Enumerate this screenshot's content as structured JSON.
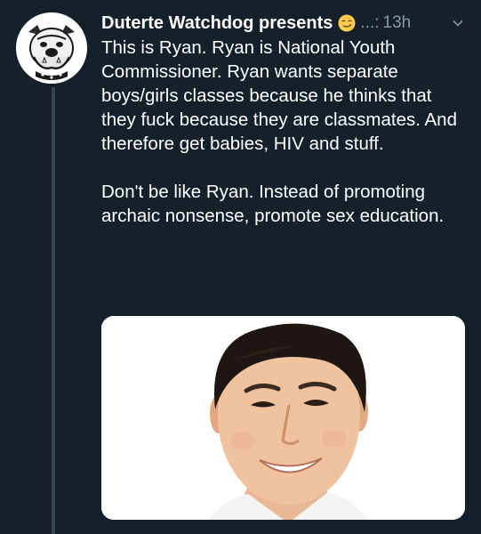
{
  "tweet": {
    "author_name": "Duterte Watchdog presents",
    "name_emoji": "smirk-emoji",
    "handle_truncated": "...:",
    "timestamp": "13h",
    "paragraphs": [
      "This is Ryan. Ryan is National Youth Commissioner. Ryan wants separate boys/girls classes because he thinks that they fuck because they are classmates. And therefore get babies, HIV and stuff.",
      "Don't be like Ryan. Instead of promoting archaic nonsense, promote sex education."
    ],
    "media_description": "portrait-photo"
  },
  "colors": {
    "background": "#15202b",
    "text": "#ffffff",
    "secondary_text": "#8899a6",
    "thread_line": "#38444d"
  }
}
